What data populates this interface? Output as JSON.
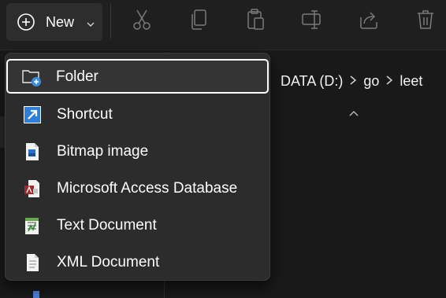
{
  "toolbar": {
    "new_label": "New",
    "new_icon": "plus-circle-icon",
    "icons": [
      "cut-icon",
      "copy-icon",
      "paste-icon",
      "rename-icon",
      "share-icon",
      "delete-icon"
    ]
  },
  "breadcrumb": {
    "items": [
      "DATA (D:)",
      "go",
      "leet"
    ]
  },
  "new_menu": {
    "items": [
      {
        "label": "Folder",
        "icon": "new-folder-icon"
      },
      {
        "label": "Shortcut",
        "icon": "shortcut-icon"
      },
      {
        "label": "Bitmap image",
        "icon": "bitmap-image-icon"
      },
      {
        "label": "Microsoft Access Database",
        "icon": "access-database-icon"
      },
      {
        "label": "Text Document",
        "icon": "text-document-icon"
      },
      {
        "label": "XML Document",
        "icon": "xml-document-icon"
      }
    ]
  },
  "colors": {
    "toolbar_bg": "#1f1f1f",
    "menu_bg": "#2c2c2c",
    "accent": "#4a9ae8",
    "focus_border": "#ffffff"
  }
}
